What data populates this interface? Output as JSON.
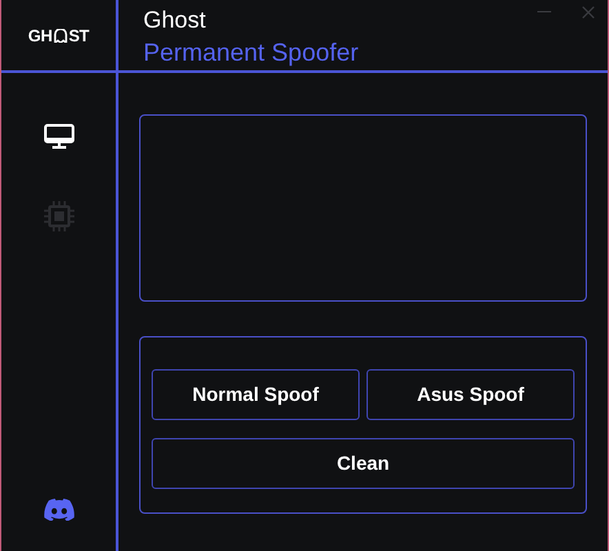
{
  "logo": {
    "left": "GH",
    "right": "ST"
  },
  "window": {
    "title": "Ghost",
    "subtitle": "Permanent Spoofer"
  },
  "sidebar": {
    "items": [
      {
        "kind": "monitor",
        "selected": true
      },
      {
        "kind": "chip",
        "selected": false
      }
    ]
  },
  "actions": {
    "buttons": [
      {
        "label": "Normal Spoof",
        "kind": "half"
      },
      {
        "label": "Asus Spoof",
        "kind": "half"
      },
      {
        "label": "Clean",
        "kind": "full"
      }
    ]
  }
}
